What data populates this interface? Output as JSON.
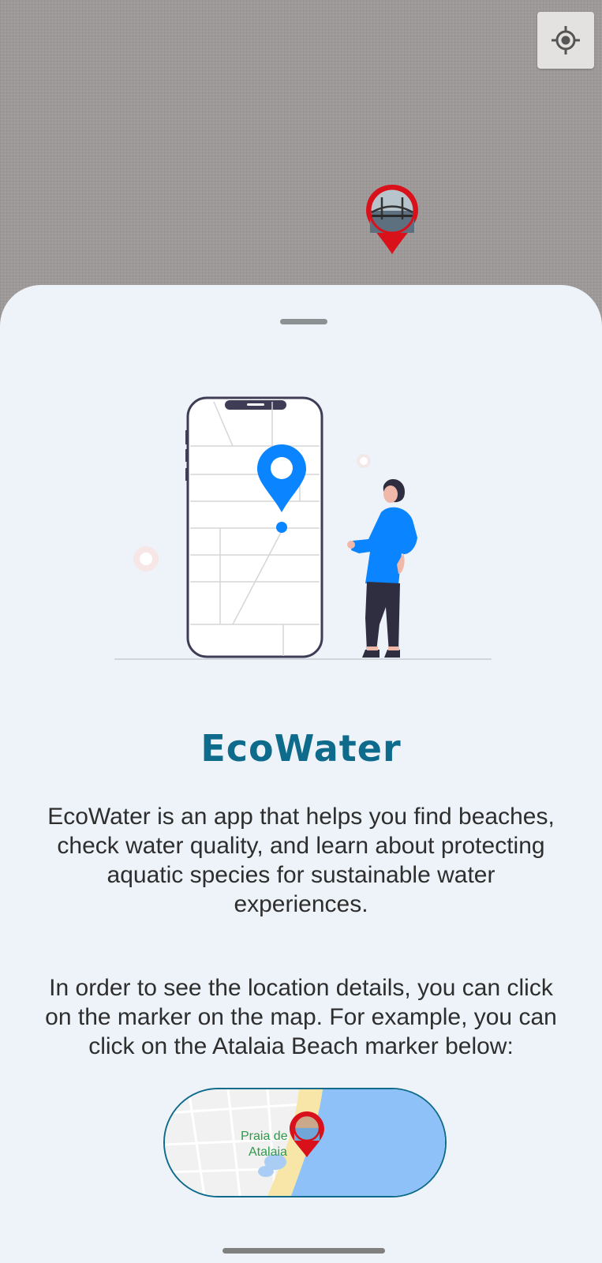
{
  "map": {
    "locate_button_icon": "my-location-crosshair-icon",
    "marker_icon": "map-pin-with-photo-icon"
  },
  "sheet": {
    "title": "EcoWater",
    "description": "EcoWater is an app that helps you find beaches, check water quality, and learn about protecting aquatic species for sustainable water experiences.",
    "instruction": "In order to see the location details, you can click on the marker on the map. For example, you can click on the Atalaia Beach marker below:",
    "example_map": {
      "label_line1": "Praia de",
      "label_line2": "Atalaia"
    }
  },
  "colors": {
    "accent": "#0e6b8c",
    "marker_red": "#d9111b",
    "pin_blue": "#0a84ff",
    "sheet_bg": "#edf3f8"
  }
}
